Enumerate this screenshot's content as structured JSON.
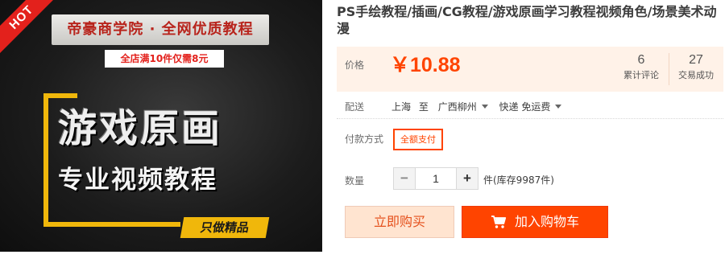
{
  "image": {
    "hot_badge": "HOT",
    "brand_banner": "帝豪商学院 · 全网优质教程",
    "promo": "全店满10件仅需8元",
    "big_title": "游戏原画",
    "sub_title": "专业视频教程",
    "slogan": "只做精品"
  },
  "title": "PS手绘教程/插画/CG教程/游戏原画学习教程视频角色/场景美术动漫",
  "price": {
    "label": "价格",
    "value": "￥10.88",
    "reviews_count": "6",
    "reviews_label": "累计评论",
    "deals_count": "27",
    "deals_label": "交易成功"
  },
  "shipping": {
    "label": "配送",
    "from": "上海",
    "to_word": "至",
    "destination": "广西柳州",
    "method": "快递 免运费"
  },
  "payment": {
    "label": "付款方式",
    "option": "全额支付"
  },
  "quantity": {
    "label": "数量",
    "minus": "−",
    "value": "1",
    "plus": "+",
    "stock": "件(库存9987件)"
  },
  "actions": {
    "buy_now": "立即购买",
    "add_to_cart": "加入购物车"
  },
  "colors": {
    "accent": "#ff4400",
    "price_bg": "#fff2e8",
    "hot_red": "#e3211c",
    "gold": "#f0b70b"
  }
}
